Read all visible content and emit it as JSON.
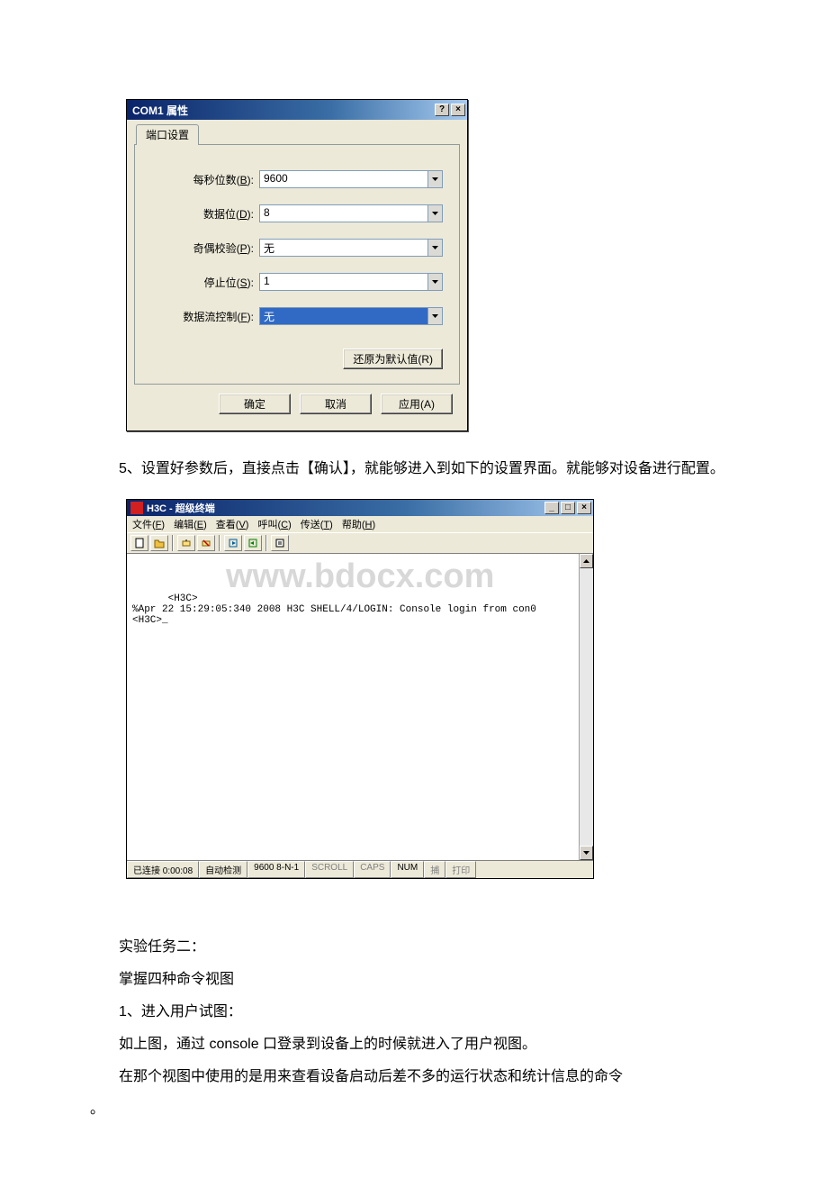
{
  "dialog": {
    "title": "COM1 属性",
    "tab": "端口设置",
    "fields": {
      "baud": {
        "label_pre": "每秒位数(",
        "hotkey": "B",
        "label_post": "):",
        "value": "9600"
      },
      "databits": {
        "label_pre": "数据位(",
        "hotkey": "D",
        "label_post": "):",
        "value": "8"
      },
      "parity": {
        "label_pre": "奇偶校验(",
        "hotkey": "P",
        "label_post": "):",
        "value": "无"
      },
      "stopbits": {
        "label_pre": "停止位(",
        "hotkey": "S",
        "label_post": "):",
        "value": "1"
      },
      "flow": {
        "label_pre": "数据流控制(",
        "hotkey": "F",
        "label_post": "):",
        "value": "无"
      }
    },
    "restore_btn": "还原为默认值(R)",
    "ok_btn": "确定",
    "cancel_btn": "取消",
    "apply_btn": "应用(A)"
  },
  "text": {
    "para5": "5、设置好参数后，直接点击【确认】，就能够进入到如下的设置界面。就能够对设备进行配置。",
    "task_title": "实验任务二：",
    "task_line": "掌握四种命令视图",
    "step1_title": "1、进入用户试图：",
    "step1_line": "如上图，通过 console 口登录到设备上的时候就进入了用户视图。",
    "step1_desc": "在那个视图中使用的是用来查看设备启动后差不多的运行状态和统计信息的命令",
    "trail": "。"
  },
  "terminal": {
    "title": "H3C - 超级终端",
    "menu": {
      "file": {
        "pre": "文件(",
        "hk": "F",
        "post": ")"
      },
      "edit": {
        "pre": "编辑(",
        "hk": "E",
        "post": ")"
      },
      "view": {
        "pre": "查看(",
        "hk": "V",
        "post": ")"
      },
      "call": {
        "pre": "呼叫(",
        "hk": "C",
        "post": ")"
      },
      "transfer": {
        "pre": "传送(",
        "hk": "T",
        "post": ")"
      },
      "help": {
        "pre": "帮助(",
        "hk": "H",
        "post": ")"
      }
    },
    "watermark": "www.bdocx.com",
    "content": "<H3C>\n%Apr 22 15:29:05:340 2008 H3C SHELL/4/LOGIN: Console login from con0\n<H3C>_",
    "status": {
      "conn": "已连接 0:00:08",
      "auto": "自动检测",
      "mode": "9600 8-N-1",
      "scroll": "SCROLL",
      "caps": "CAPS",
      "num": "NUM",
      "capture": "捕",
      "print": "打印"
    }
  }
}
